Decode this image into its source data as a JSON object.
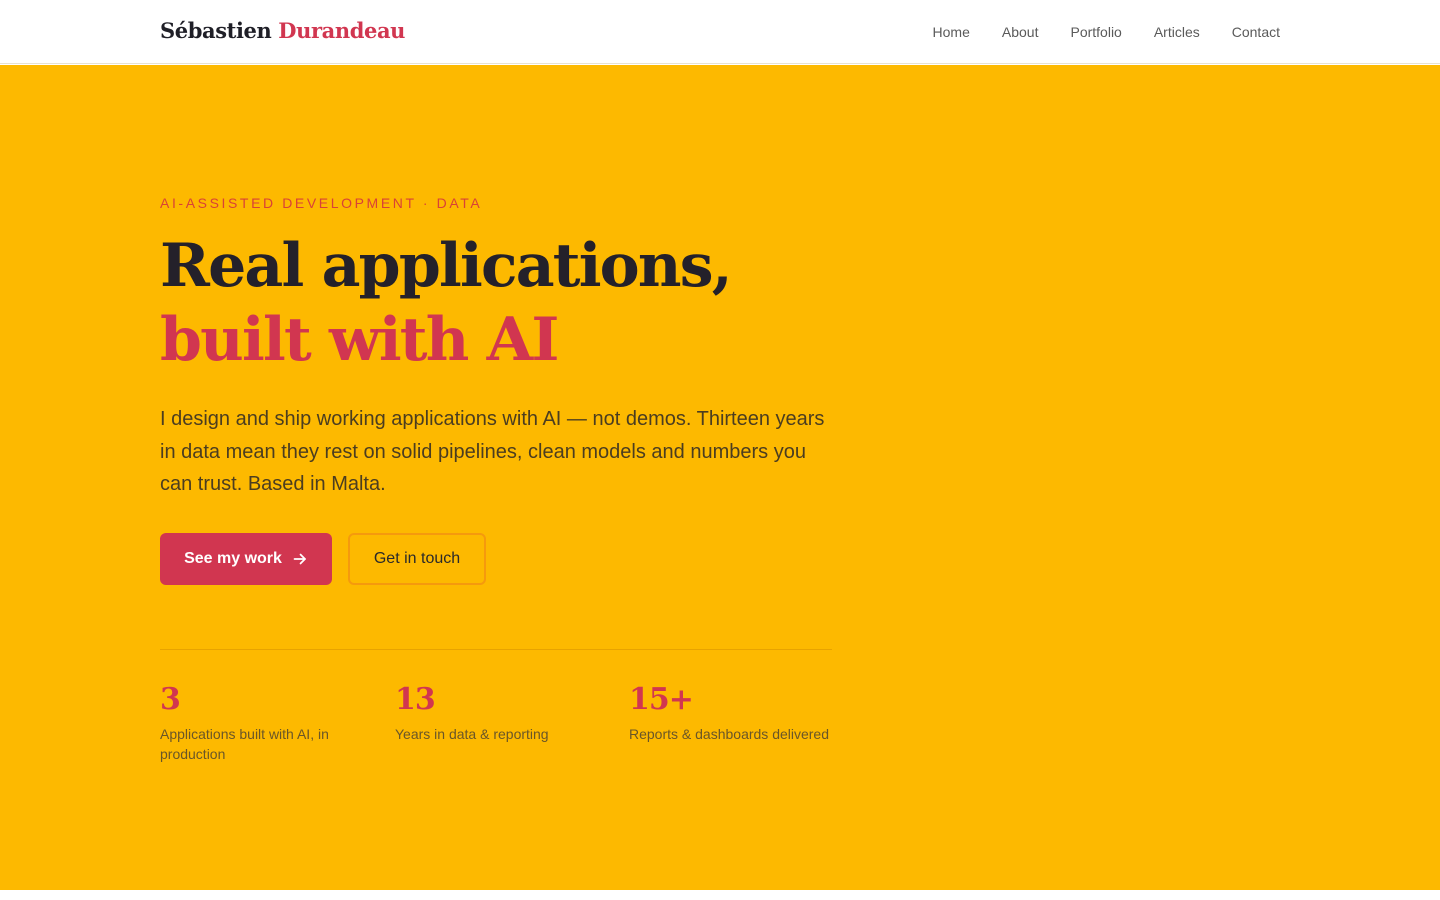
{
  "brand": {
    "first": "Sébastien",
    "last": "Durandeau"
  },
  "nav": {
    "items": [
      {
        "label": "Home"
      },
      {
        "label": "About"
      },
      {
        "label": "Portfolio"
      },
      {
        "label": "Articles"
      },
      {
        "label": "Contact"
      }
    ]
  },
  "hero": {
    "eyebrow": "AI-ASSISTED DEVELOPMENT · DATA",
    "headline_line1": "Real applications,",
    "headline_line2": "built with AI",
    "lede": "I design and ship working applications with AI — not demos. Thirteen years in data mean they rest on solid pipelines, clean models and numbers you can trust. Based in Malta.",
    "primary_cta": "See my work",
    "primary_cta_icon": "arrow-right-icon",
    "secondary_cta": "Get in touch"
  },
  "stats": [
    {
      "value": "3",
      "label": "Applications built with AI, in production"
    },
    {
      "value": "13",
      "label": "Years in data & reporting"
    },
    {
      "value": "15+",
      "label": "Reports & dashboards delivered"
    }
  ],
  "colors": {
    "accent": "#d13650",
    "hero_background": "#fdb900",
    "eyebrow": "#d94236",
    "heading": "#24212a",
    "secondary_button_border": "#f59a0d"
  }
}
